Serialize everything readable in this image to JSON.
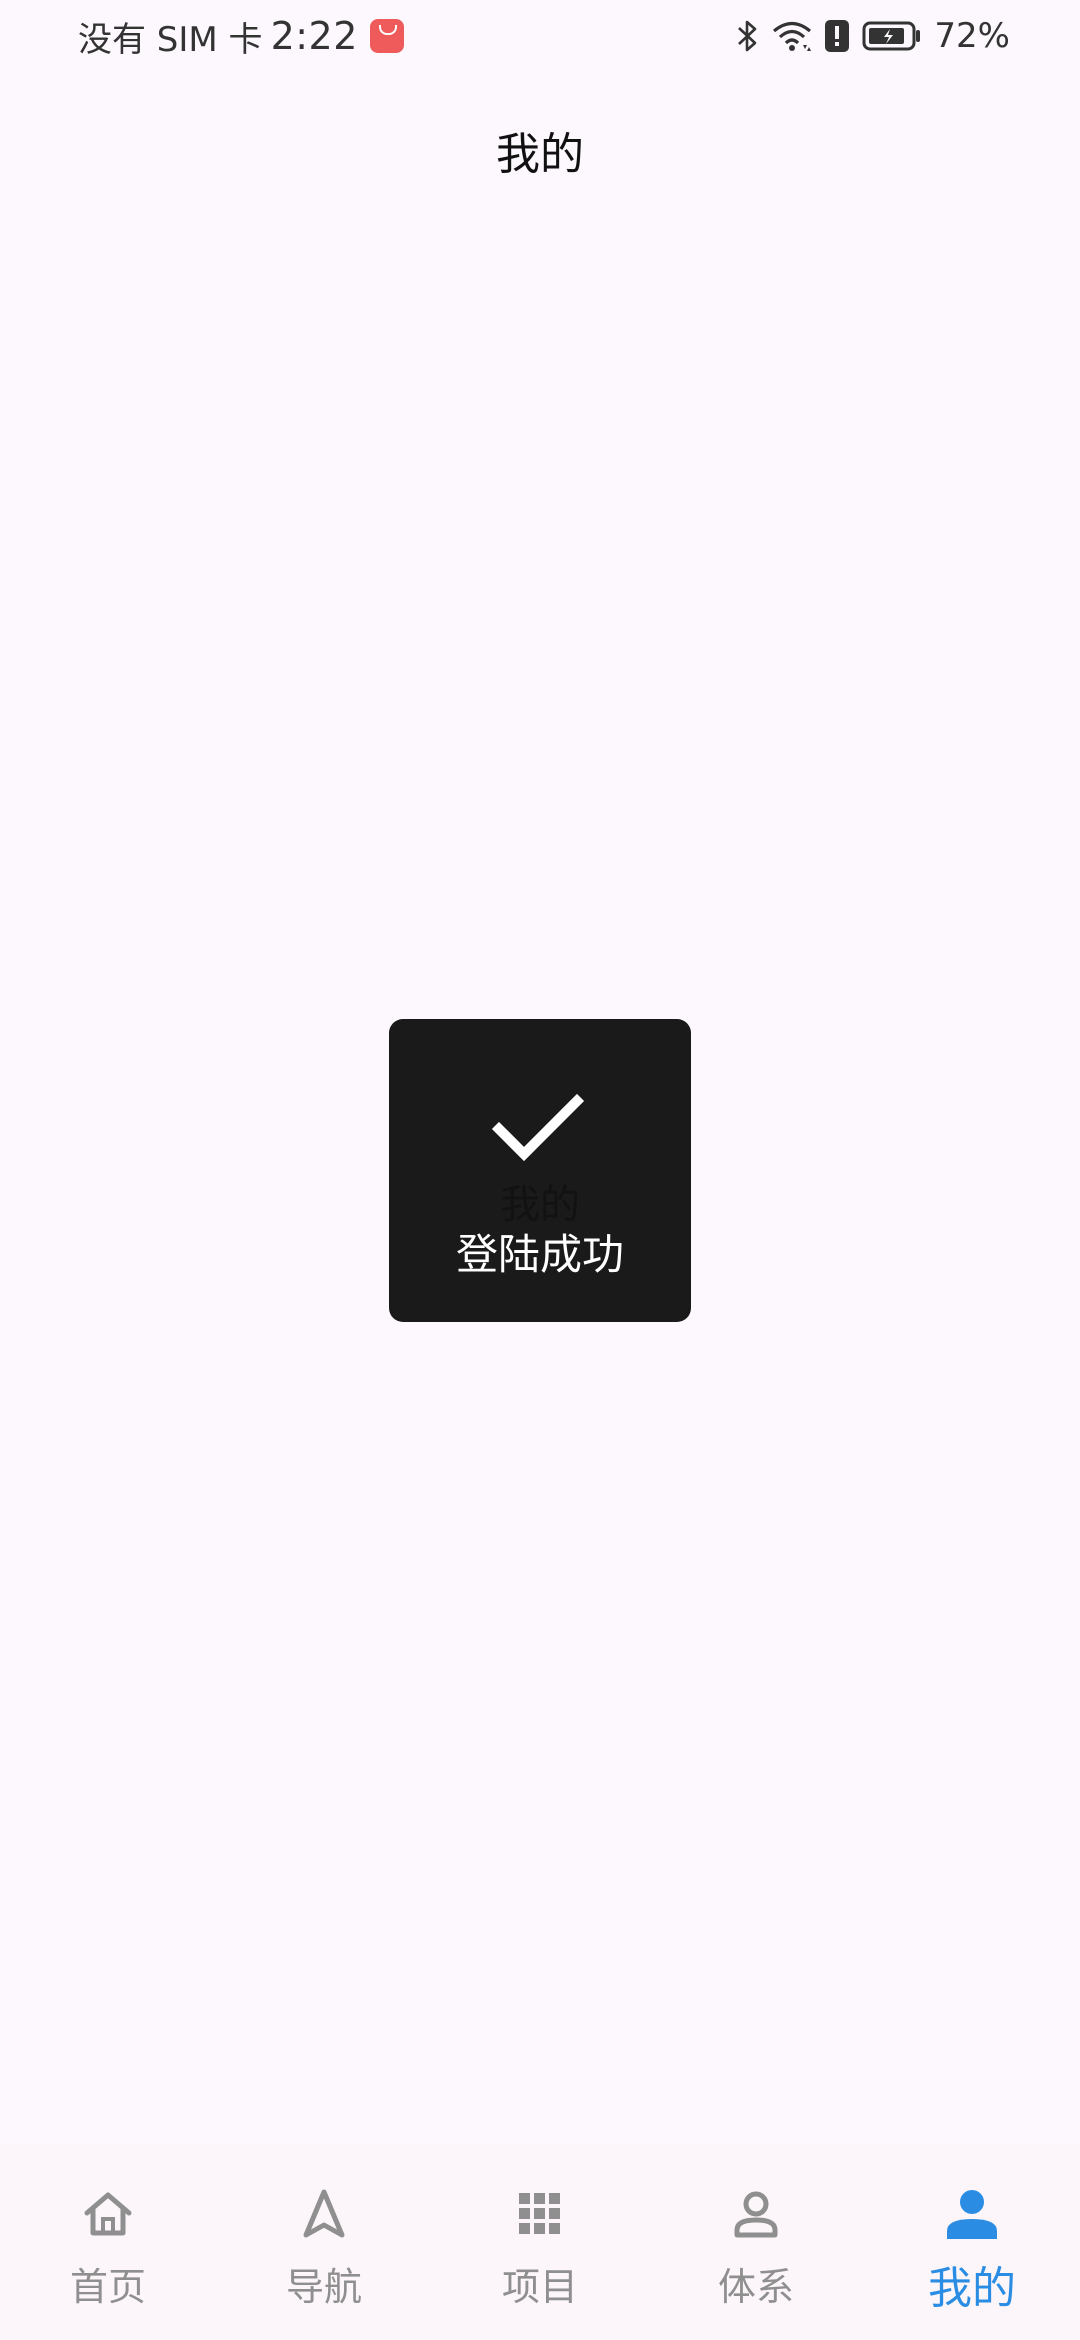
{
  "status_bar": {
    "carrier": "没有 SIM 卡",
    "time": "2:22",
    "battery_percent": "72%",
    "icons": [
      "app-badge-icon",
      "bluetooth-icon",
      "wifi-icon",
      "alert-icon",
      "battery-icon"
    ]
  },
  "title_bar": {
    "title": "我的"
  },
  "toast": {
    "icon": "checkmark-icon",
    "ghost_title": "我的",
    "message": "登陆成功"
  },
  "bottom_nav": {
    "active_index": 4,
    "active_color": "#2a8de3",
    "inactive_color": "#8f8f8f",
    "items": [
      {
        "label": "首页",
        "icon": "home-icon"
      },
      {
        "label": "导航",
        "icon": "navigation-icon"
      },
      {
        "label": "项目",
        "icon": "grid-icon"
      },
      {
        "label": "体系",
        "icon": "person-outline-icon"
      },
      {
        "label": "我的",
        "icon": "person-filled-icon"
      }
    ]
  }
}
